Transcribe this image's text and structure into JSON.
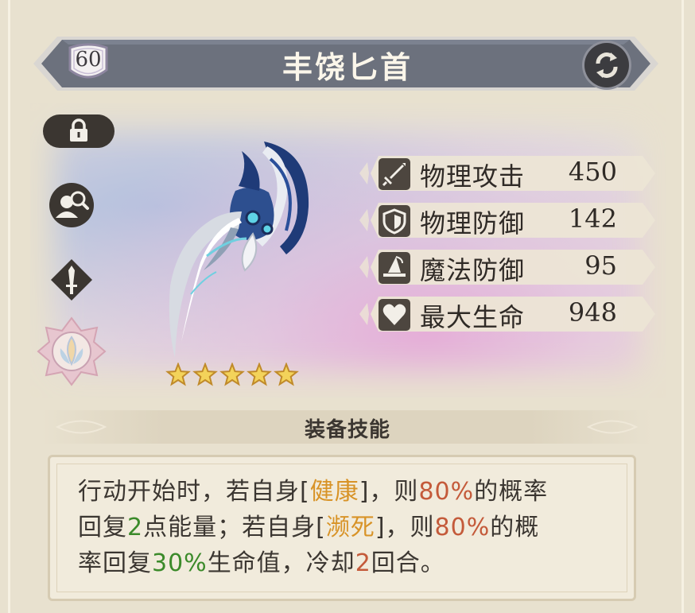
{
  "item": {
    "level": "60",
    "name": "丰饶匕首",
    "stars": 5
  },
  "stats": [
    {
      "icon": "sword-icon",
      "label": "物理攻击",
      "value": "450"
    },
    {
      "icon": "shield-icon",
      "label": "物理防御",
      "value": "142"
    },
    {
      "icon": "wizard-hat-icon",
      "label": "魔法防御",
      "value": "95"
    },
    {
      "icon": "heart-icon",
      "label": "最大生命",
      "value": "948"
    }
  ],
  "skill": {
    "header": "装备技能",
    "line1": {
      "p1": "行动开始时，若自身[",
      "k1": "健康",
      "p2": "]，则",
      "n1": "80%",
      "p3": "的概率"
    },
    "line2": {
      "p1": "回复",
      "n1": "2",
      "p2": "点能量；若自身[",
      "k1": "濒死",
      "p3": "]，则",
      "n2": "80%",
      "p4": "的概"
    },
    "line3": {
      "p1": "率回复",
      "n1": "30%",
      "p2": "生命值，冷却",
      "n2": "2",
      "p3": "回合。"
    }
  },
  "colors": {
    "title_bar": "#6c717d",
    "accent_gold": "#d89327",
    "accent_red": "#c45a3a",
    "accent_green": "#3b8a2a"
  }
}
